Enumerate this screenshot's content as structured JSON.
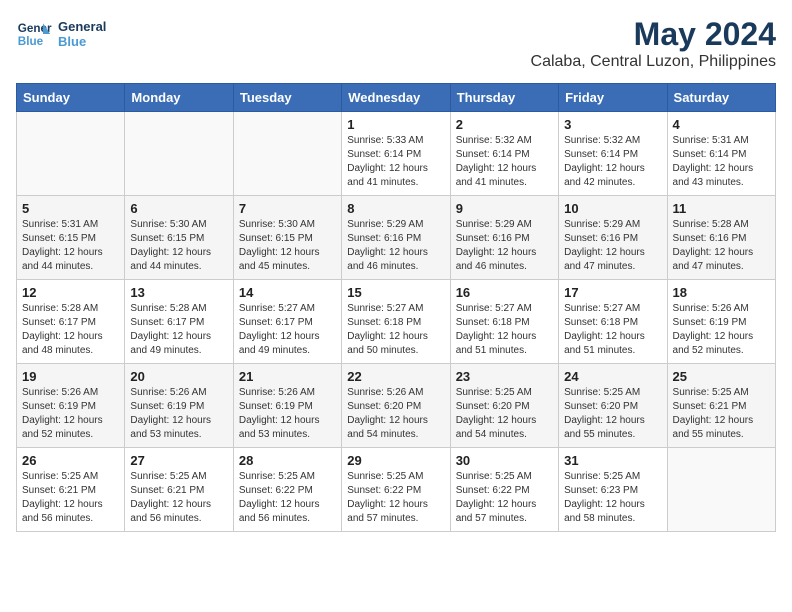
{
  "logo": {
    "line1": "General",
    "line2": "Blue"
  },
  "title": "May 2024",
  "subtitle": "Calaba, Central Luzon, Philippines",
  "weekdays": [
    "Sunday",
    "Monday",
    "Tuesday",
    "Wednesday",
    "Thursday",
    "Friday",
    "Saturday"
  ],
  "weeks": [
    [
      {
        "day": "",
        "sunrise": "",
        "sunset": "",
        "daylight": ""
      },
      {
        "day": "",
        "sunrise": "",
        "sunset": "",
        "daylight": ""
      },
      {
        "day": "",
        "sunrise": "",
        "sunset": "",
        "daylight": ""
      },
      {
        "day": "1",
        "sunrise": "Sunrise: 5:33 AM",
        "sunset": "Sunset: 6:14 PM",
        "daylight": "Daylight: 12 hours and 41 minutes."
      },
      {
        "day": "2",
        "sunrise": "Sunrise: 5:32 AM",
        "sunset": "Sunset: 6:14 PM",
        "daylight": "Daylight: 12 hours and 41 minutes."
      },
      {
        "day": "3",
        "sunrise": "Sunrise: 5:32 AM",
        "sunset": "Sunset: 6:14 PM",
        "daylight": "Daylight: 12 hours and 42 minutes."
      },
      {
        "day": "4",
        "sunrise": "Sunrise: 5:31 AM",
        "sunset": "Sunset: 6:14 PM",
        "daylight": "Daylight: 12 hours and 43 minutes."
      }
    ],
    [
      {
        "day": "5",
        "sunrise": "Sunrise: 5:31 AM",
        "sunset": "Sunset: 6:15 PM",
        "daylight": "Daylight: 12 hours and 44 minutes."
      },
      {
        "day": "6",
        "sunrise": "Sunrise: 5:30 AM",
        "sunset": "Sunset: 6:15 PM",
        "daylight": "Daylight: 12 hours and 44 minutes."
      },
      {
        "day": "7",
        "sunrise": "Sunrise: 5:30 AM",
        "sunset": "Sunset: 6:15 PM",
        "daylight": "Daylight: 12 hours and 45 minutes."
      },
      {
        "day": "8",
        "sunrise": "Sunrise: 5:29 AM",
        "sunset": "Sunset: 6:16 PM",
        "daylight": "Daylight: 12 hours and 46 minutes."
      },
      {
        "day": "9",
        "sunrise": "Sunrise: 5:29 AM",
        "sunset": "Sunset: 6:16 PM",
        "daylight": "Daylight: 12 hours and 46 minutes."
      },
      {
        "day": "10",
        "sunrise": "Sunrise: 5:29 AM",
        "sunset": "Sunset: 6:16 PM",
        "daylight": "Daylight: 12 hours and 47 minutes."
      },
      {
        "day": "11",
        "sunrise": "Sunrise: 5:28 AM",
        "sunset": "Sunset: 6:16 PM",
        "daylight": "Daylight: 12 hours and 47 minutes."
      }
    ],
    [
      {
        "day": "12",
        "sunrise": "Sunrise: 5:28 AM",
        "sunset": "Sunset: 6:17 PM",
        "daylight": "Daylight: 12 hours and 48 minutes."
      },
      {
        "day": "13",
        "sunrise": "Sunrise: 5:28 AM",
        "sunset": "Sunset: 6:17 PM",
        "daylight": "Daylight: 12 hours and 49 minutes."
      },
      {
        "day": "14",
        "sunrise": "Sunrise: 5:27 AM",
        "sunset": "Sunset: 6:17 PM",
        "daylight": "Daylight: 12 hours and 49 minutes."
      },
      {
        "day": "15",
        "sunrise": "Sunrise: 5:27 AM",
        "sunset": "Sunset: 6:18 PM",
        "daylight": "Daylight: 12 hours and 50 minutes."
      },
      {
        "day": "16",
        "sunrise": "Sunrise: 5:27 AM",
        "sunset": "Sunset: 6:18 PM",
        "daylight": "Daylight: 12 hours and 51 minutes."
      },
      {
        "day": "17",
        "sunrise": "Sunrise: 5:27 AM",
        "sunset": "Sunset: 6:18 PM",
        "daylight": "Daylight: 12 hours and 51 minutes."
      },
      {
        "day": "18",
        "sunrise": "Sunrise: 5:26 AM",
        "sunset": "Sunset: 6:19 PM",
        "daylight": "Daylight: 12 hours and 52 minutes."
      }
    ],
    [
      {
        "day": "19",
        "sunrise": "Sunrise: 5:26 AM",
        "sunset": "Sunset: 6:19 PM",
        "daylight": "Daylight: 12 hours and 52 minutes."
      },
      {
        "day": "20",
        "sunrise": "Sunrise: 5:26 AM",
        "sunset": "Sunset: 6:19 PM",
        "daylight": "Daylight: 12 hours and 53 minutes."
      },
      {
        "day": "21",
        "sunrise": "Sunrise: 5:26 AM",
        "sunset": "Sunset: 6:19 PM",
        "daylight": "Daylight: 12 hours and 53 minutes."
      },
      {
        "day": "22",
        "sunrise": "Sunrise: 5:26 AM",
        "sunset": "Sunset: 6:20 PM",
        "daylight": "Daylight: 12 hours and 54 minutes."
      },
      {
        "day": "23",
        "sunrise": "Sunrise: 5:25 AM",
        "sunset": "Sunset: 6:20 PM",
        "daylight": "Daylight: 12 hours and 54 minutes."
      },
      {
        "day": "24",
        "sunrise": "Sunrise: 5:25 AM",
        "sunset": "Sunset: 6:20 PM",
        "daylight": "Daylight: 12 hours and 55 minutes."
      },
      {
        "day": "25",
        "sunrise": "Sunrise: 5:25 AM",
        "sunset": "Sunset: 6:21 PM",
        "daylight": "Daylight: 12 hours and 55 minutes."
      }
    ],
    [
      {
        "day": "26",
        "sunrise": "Sunrise: 5:25 AM",
        "sunset": "Sunset: 6:21 PM",
        "daylight": "Daylight: 12 hours and 56 minutes."
      },
      {
        "day": "27",
        "sunrise": "Sunrise: 5:25 AM",
        "sunset": "Sunset: 6:21 PM",
        "daylight": "Daylight: 12 hours and 56 minutes."
      },
      {
        "day": "28",
        "sunrise": "Sunrise: 5:25 AM",
        "sunset": "Sunset: 6:22 PM",
        "daylight": "Daylight: 12 hours and 56 minutes."
      },
      {
        "day": "29",
        "sunrise": "Sunrise: 5:25 AM",
        "sunset": "Sunset: 6:22 PM",
        "daylight": "Daylight: 12 hours and 57 minutes."
      },
      {
        "day": "30",
        "sunrise": "Sunrise: 5:25 AM",
        "sunset": "Sunset: 6:22 PM",
        "daylight": "Daylight: 12 hours and 57 minutes."
      },
      {
        "day": "31",
        "sunrise": "Sunrise: 5:25 AM",
        "sunset": "Sunset: 6:23 PM",
        "daylight": "Daylight: 12 hours and 58 minutes."
      },
      {
        "day": "",
        "sunrise": "",
        "sunset": "",
        "daylight": ""
      }
    ]
  ]
}
